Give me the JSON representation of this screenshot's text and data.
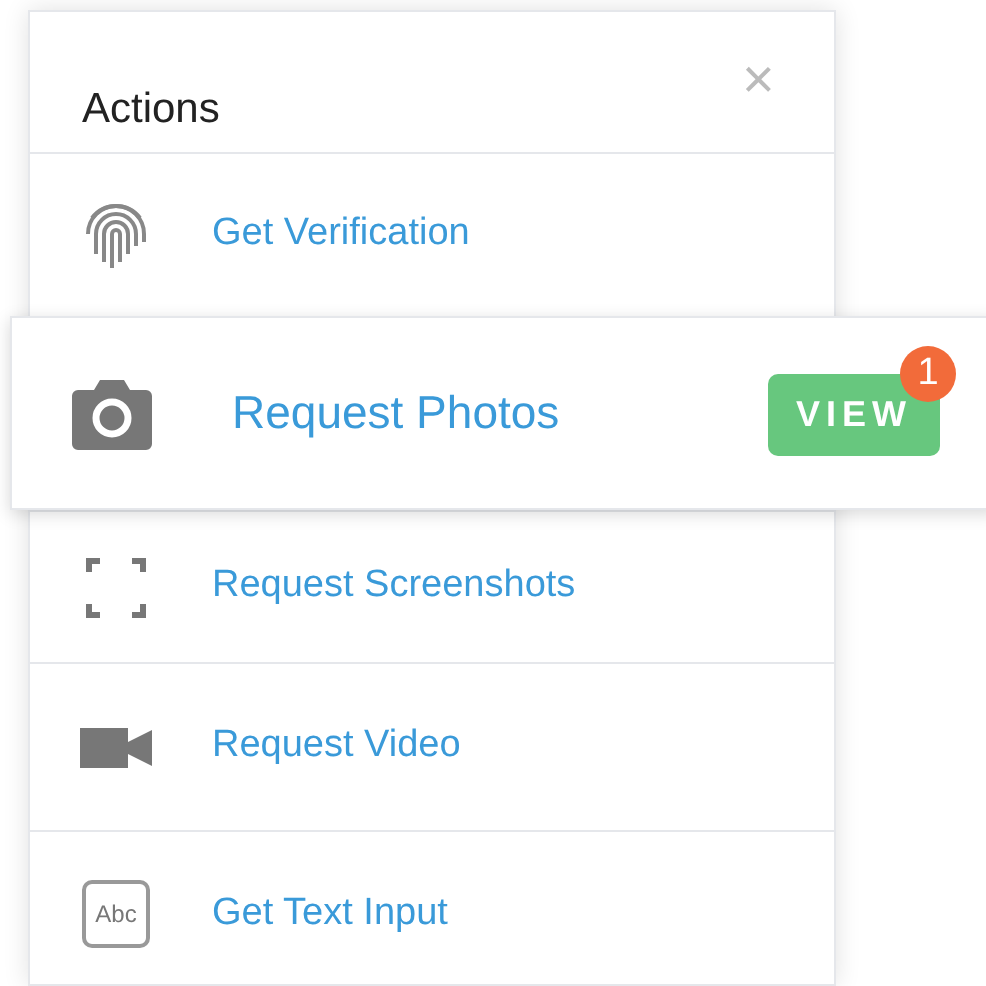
{
  "panel": {
    "title": "Actions",
    "close": "×"
  },
  "items": [
    {
      "kind": "fingerprint",
      "label": "Get Verification",
      "highlighted": false
    },
    {
      "kind": "camera",
      "label": "Request Photos",
      "highlighted": true,
      "action": {
        "label": "VIEW",
        "badge": "1"
      }
    },
    {
      "kind": "screenshot",
      "label": "Request Screenshots",
      "highlighted": false
    },
    {
      "kind": "video",
      "label": "Request Video",
      "highlighted": false
    },
    {
      "kind": "textinput",
      "label": "Get Text Input",
      "highlighted": false,
      "icon_label": "Abc"
    }
  ]
}
